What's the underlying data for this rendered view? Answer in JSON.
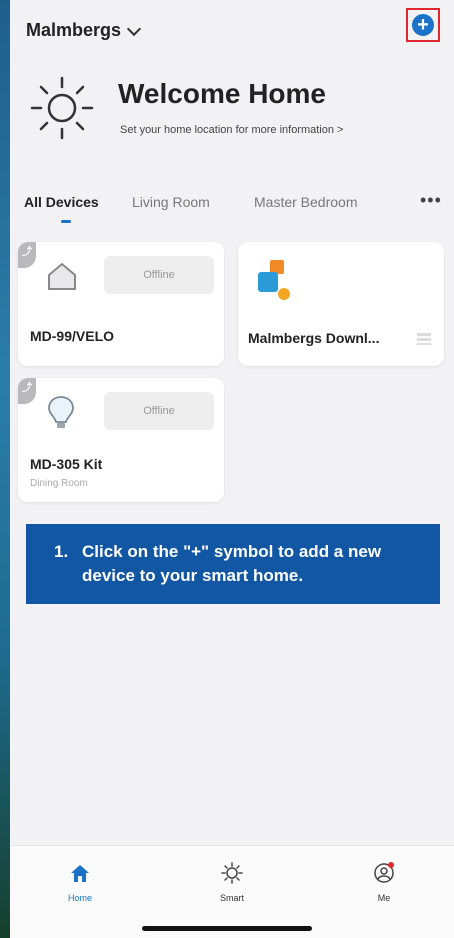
{
  "header": {
    "home_name": "Malmbergs"
  },
  "welcome": {
    "title": "Welcome Home",
    "subtitle": "Set your home location for more information >"
  },
  "tabs": [
    "All Devices",
    "Living Room",
    "Master Bedroom"
  ],
  "devices": [
    {
      "name": "MD-99/VELO",
      "status": "Offline",
      "room": ""
    },
    {
      "name": "Malmbergs Downl...",
      "status": "",
      "room": ""
    },
    {
      "name": "MD-305 Kit",
      "status": "Offline",
      "room": "Dining Room"
    }
  ],
  "instruction": {
    "number": "1.",
    "text": "Click on the \"+\" symbol to add a new device to your smart home."
  },
  "nav": [
    {
      "label": "Home",
      "icon": "home-icon"
    },
    {
      "label": "Smart",
      "icon": "sun-icon"
    },
    {
      "label": "Me",
      "icon": "profile-icon"
    }
  ],
  "colors": {
    "accent": "#1a73c8",
    "instruction_bg": "#1257a3",
    "highlight": "#e0262f"
  }
}
